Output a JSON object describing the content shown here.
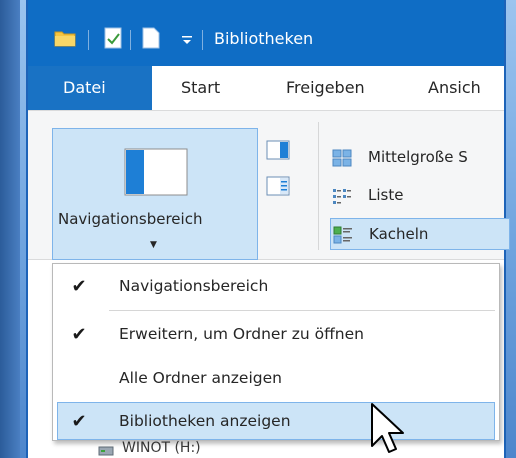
{
  "window": {
    "title": "Bibliotheken"
  },
  "ribbon_tabs": [
    {
      "label": "Datei",
      "active": true
    },
    {
      "label": "Start"
    },
    {
      "label": "Freigeben"
    },
    {
      "label": "Ansich"
    }
  ],
  "ribbon": {
    "navpane_button": "Navigationsbereich",
    "layout_options": [
      {
        "label": "Mittelgroße S",
        "selected": false
      },
      {
        "label": "Liste",
        "selected": false
      },
      {
        "label": "Kacheln",
        "selected": true
      }
    ]
  },
  "menu": {
    "items": [
      {
        "label": "Navigationsbereich",
        "checked": true
      },
      {
        "label": "Erweitern, um Ordner zu öffnen",
        "checked": true
      },
      {
        "label": "Alle Ordner anzeigen",
        "checked": false
      },
      {
        "label": "Bibliotheken anzeigen",
        "checked": true
      }
    ]
  },
  "background_item": {
    "label": "WINOT (H:)"
  },
  "colors": {
    "titlebar": "#0f6dc5",
    "active_tab": "#1972c4",
    "highlight": "#cce4f7",
    "highlight_border": "#7eb4ea"
  }
}
